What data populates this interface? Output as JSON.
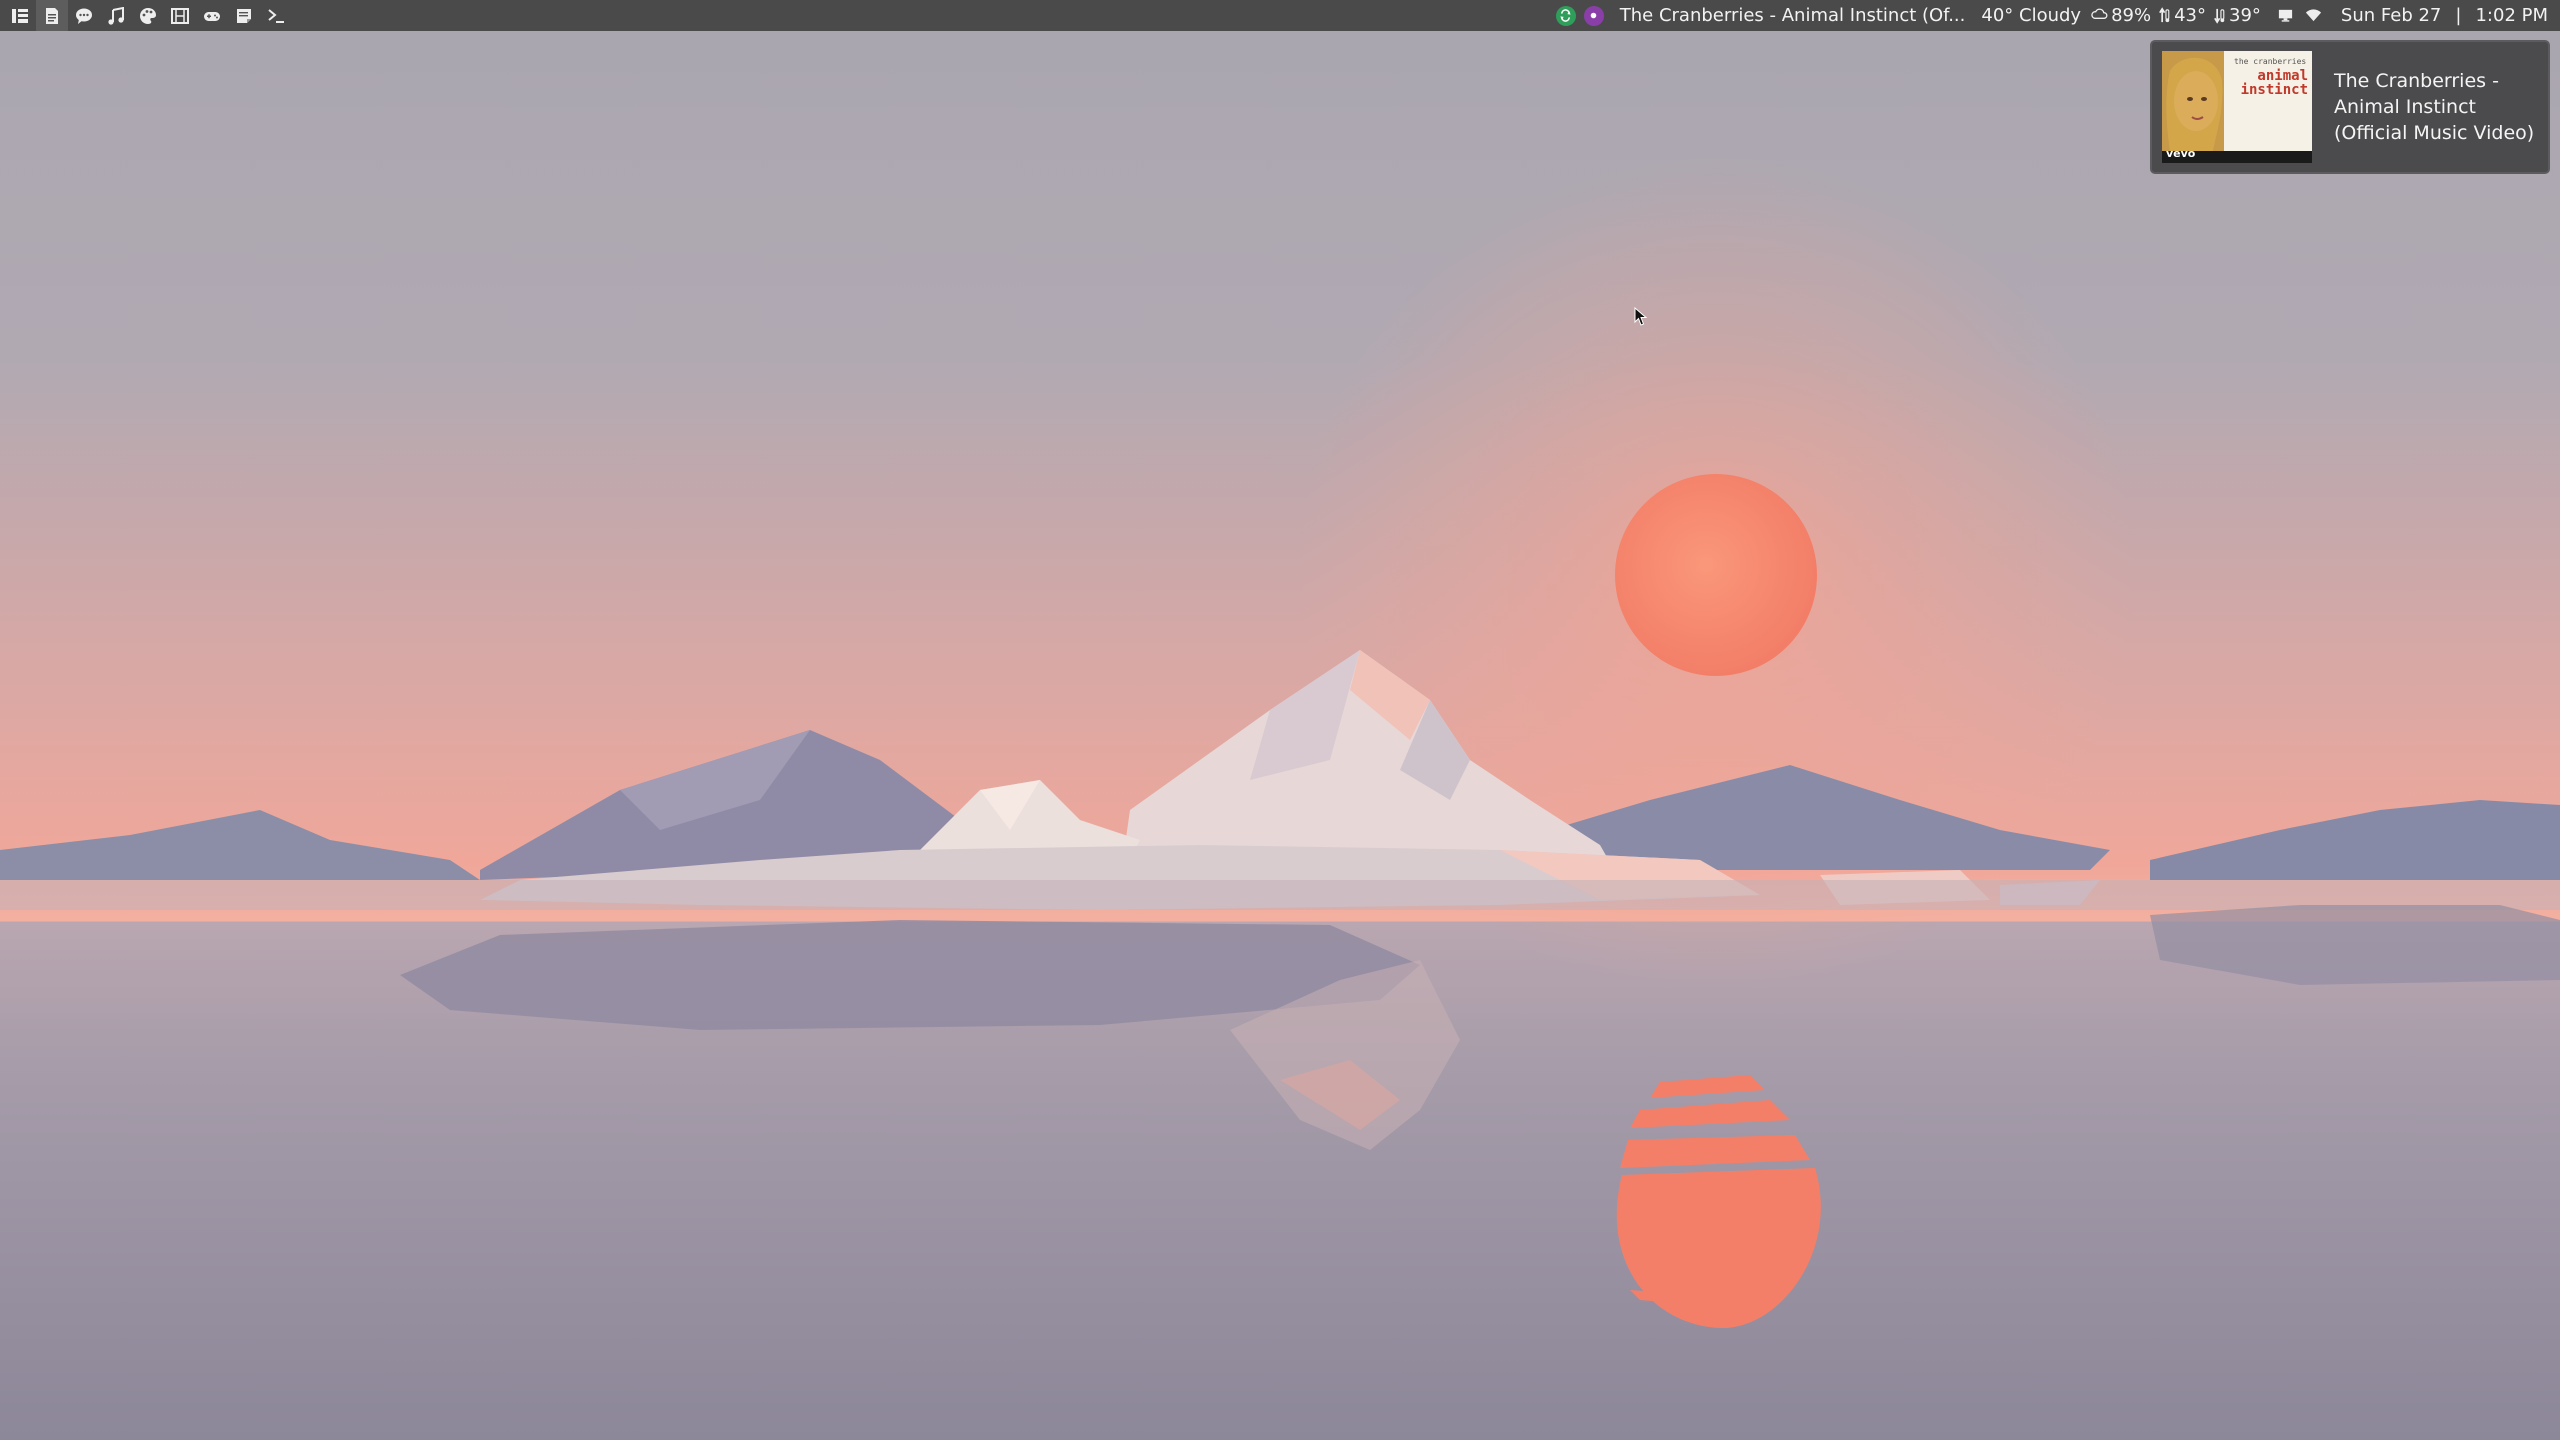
{
  "panel": {
    "launchers": [
      {
        "icon": "app-menu-icon"
      },
      {
        "icon": "documents-icon"
      },
      {
        "icon": "chat-icon"
      },
      {
        "icon": "music-icon"
      },
      {
        "icon": "palette-icon"
      },
      {
        "icon": "video-icon"
      },
      {
        "icon": "gamepad-icon"
      },
      {
        "icon": "notes-icon"
      },
      {
        "icon": "terminal-icon"
      }
    ],
    "tray": {
      "sync_icon": "sync-icon",
      "media_icon": "media-player-icon",
      "now_playing": "The Cranberries - Animal Instinct (Of...",
      "weather": "40° Cloudy",
      "humidity": "89%",
      "high": "43°",
      "low": "39°",
      "display_icon": "display-icon",
      "wifi_icon": "wifi-icon",
      "date": "Sun Feb 27",
      "separator": "|",
      "time": "1:02 PM"
    }
  },
  "notification": {
    "title": "The Cranberries - Animal Instinct (Official Music Video)",
    "thumbnail": {
      "band_text": "the cranberries",
      "song_text": "animal instinct",
      "label": "vevo"
    }
  },
  "colors": {
    "panel_bg": "#4a4a4a",
    "sun": "#f7876c",
    "sky_top": "#a9a7b2",
    "sky_glow": "#f2a497",
    "water": "#9c95a5"
  }
}
